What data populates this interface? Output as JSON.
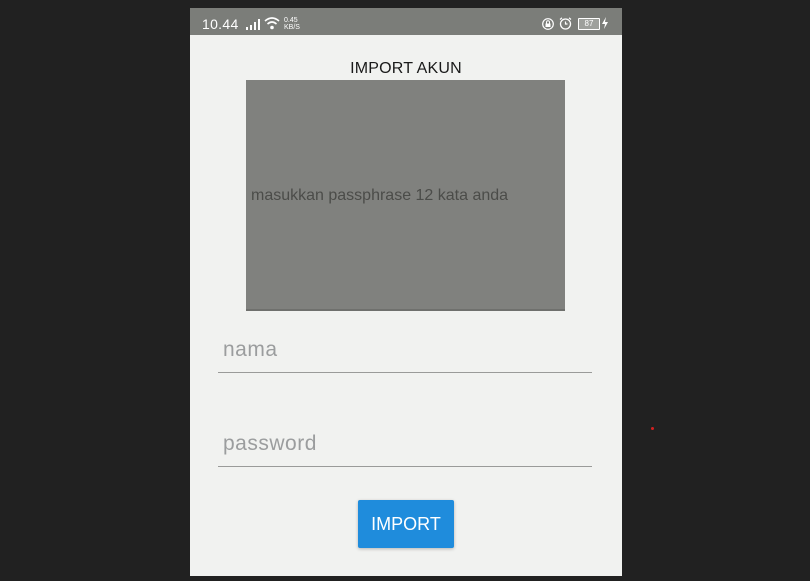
{
  "status_bar": {
    "time": "10.44",
    "speed_value": "0.45",
    "speed_unit": "KB/S",
    "battery": "87",
    "icons": [
      "signal-icon",
      "wifi-icon",
      "lock-rotation-icon",
      "alarm-icon",
      "battery-icon",
      "charging-bolt-icon"
    ]
  },
  "screen": {
    "title": "IMPORT AKUN",
    "passphrase_placeholder": "masukkan passphrase 12 kata anda",
    "name_placeholder": "nama",
    "password_placeholder": "password",
    "import_button": "IMPORT"
  },
  "colors": {
    "background": "#212121",
    "status_bar": "#7b7d79",
    "screen_bg": "#f1f2f0",
    "passphrase_box": "#80817e",
    "button": "#1f8cdc",
    "cursor_dot": "#d32020"
  }
}
